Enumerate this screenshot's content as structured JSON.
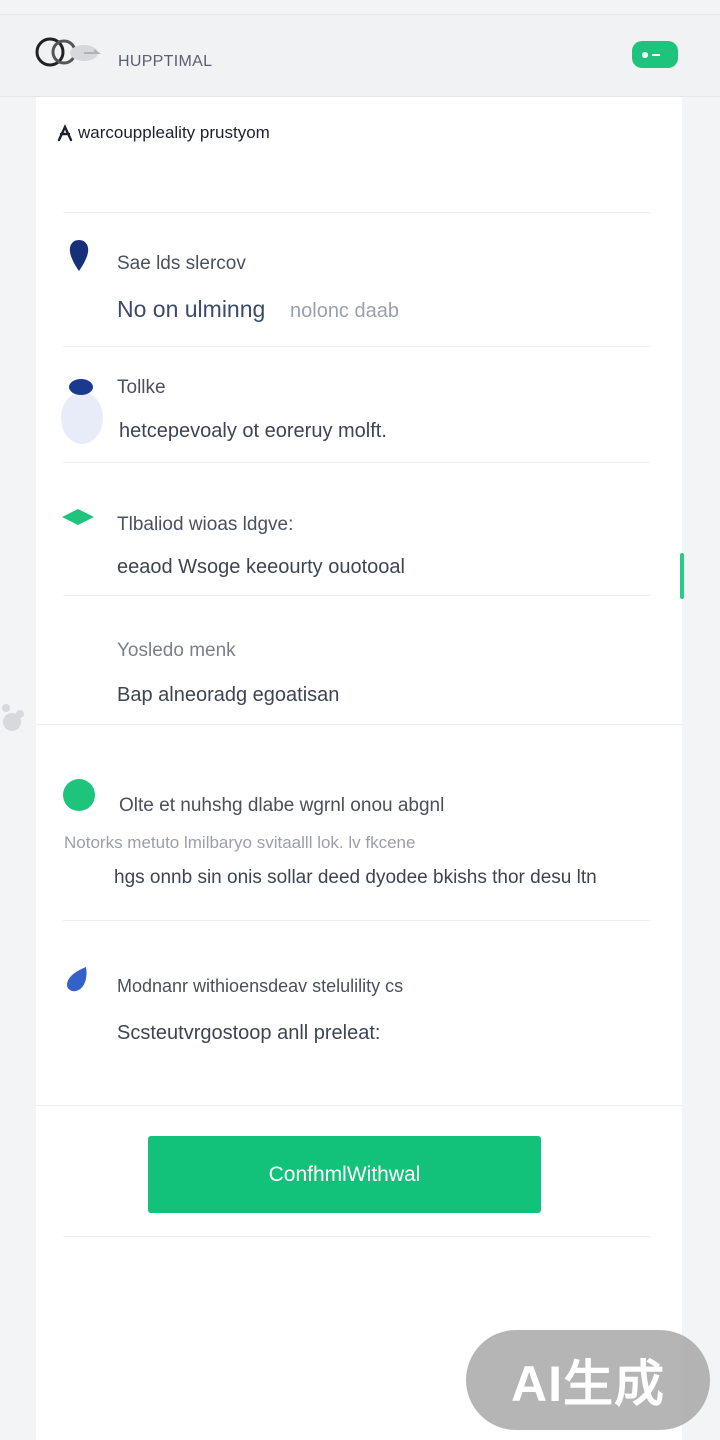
{
  "header": {
    "app_name": "HUPPTIMAL"
  },
  "card": {
    "title": "warcouppleality prustyom"
  },
  "items": [
    {
      "title": "Sae lds slercov",
      "value": "No on ulminng",
      "value_suffix": "nolonc daab"
    },
    {
      "title": "Tollke",
      "value": "hetcepevoaly ot eoreruy molft."
    },
    {
      "title": "Tlbaliod wioas ldgve:",
      "value": "eeaod Wsoge keeourty ouotooal"
    },
    {
      "title": "Yosledo menk",
      "value": "Bap alneoradg egoatisan"
    },
    {
      "title": "Olte et nuhshg dlabe wgrnl onou abgnl",
      "note": "Notorks metuto lmilbaryo svitaalll lok. lv fkcene",
      "value": "hgs onnb sin onis sollar deed dyodee bkishs thor desu ltn"
    },
    {
      "title": "Modnanr withioensdeav stelulility cs",
      "value": "Scsteutvrgostoop anll preleat:"
    }
  ],
  "confirm_label": "ConfhmlWithwal",
  "watermark": "AI生成",
  "colors": {
    "accent_green": "#13c27a",
    "navy": "#17307a",
    "blue": "#3360c9"
  }
}
